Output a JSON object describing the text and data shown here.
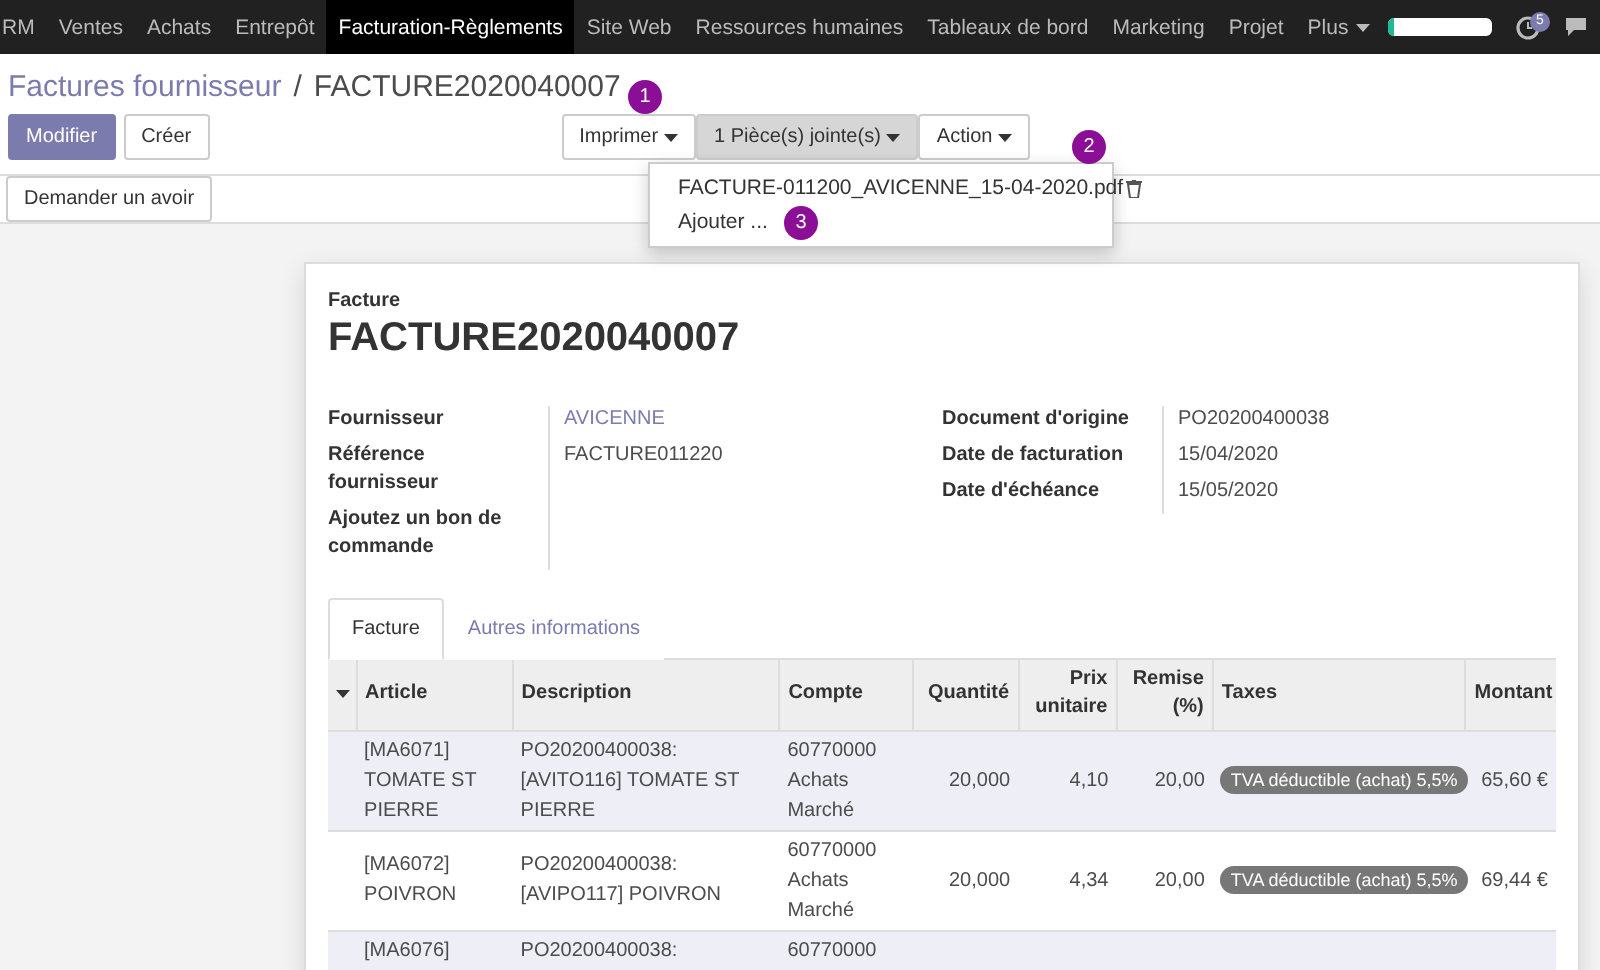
{
  "navbar": {
    "menu": [
      {
        "label": "RM",
        "selected": false
      },
      {
        "label": "Ventes",
        "selected": false
      },
      {
        "label": "Achats",
        "selected": false
      },
      {
        "label": "Entrepôt",
        "selected": false
      },
      {
        "label": "Facturation-Règlements",
        "selected": true
      },
      {
        "label": "Site Web",
        "selected": false
      },
      {
        "label": "Ressources humaines",
        "selected": false
      },
      {
        "label": "Tableaux de bord",
        "selected": false
      },
      {
        "label": "Marketing",
        "selected": false
      },
      {
        "label": "Projet",
        "selected": false
      },
      {
        "label": "Plus",
        "selected": false
      }
    ],
    "progress": {
      "level": 0.05
    },
    "notification_count": "5"
  },
  "breadcrumb": {
    "parent": "Factures fournisseur",
    "separator": "/",
    "current": "FACTURE2020040007"
  },
  "buttons": {
    "edit": "Modifier",
    "create": "Créer",
    "print": "Imprimer",
    "attachments": "1 Pièce(s) jointe(s)",
    "action": "Action",
    "credit_note": "Demander un avoir"
  },
  "attachments_menu": {
    "file": "FACTURE-011200_AVICENNE_15-04-2020.pdf",
    "add": "Ajouter ..."
  },
  "annotations": [
    "1",
    "2",
    "3"
  ],
  "invoice": {
    "type_label": "Facture",
    "number": "FACTURE2020040007",
    "left_fields": [
      {
        "label": "Fournisseur",
        "value": "AVICENNE",
        "kind": "link"
      },
      {
        "label": "Référence fournisseur",
        "value": "FACTURE011220",
        "kind": "text"
      },
      {
        "label": "Ajoutez un bon de commande",
        "kind": "text"
      }
    ],
    "right_fields": [
      {
        "label": "Document d'origine",
        "value": "PO20200400038"
      },
      {
        "label": "Date de facturation",
        "value": "15/04/2020"
      },
      {
        "label": "Date d'échéance",
        "value": "15/05/2020"
      }
    ]
  },
  "tabs": [
    {
      "label": "Facture",
      "selected": true
    },
    {
      "label": "Autres informations",
      "selected": false
    }
  ],
  "table": {
    "columns": [
      "Article",
      "Description",
      "Compte",
      "Quantité",
      "Prix unitaire",
      "Remise (%)",
      "Taxes",
      "Montant"
    ],
    "rows": [
      {
        "article": "[MA6071] TOMATE ST PIERRE",
        "description": "PO20200400038: [AVITO116] TOMATE ST PIERRE",
        "account": "60770000 Achats Marché",
        "quantity": "20,000",
        "unit_price": "4,10",
        "discount": "20,00",
        "tax": "TVA déductible (achat) 5,5%",
        "amount": "65,60 €",
        "selected": true
      },
      {
        "article": "[MA6072] POIVRON",
        "description": "PO20200400038: [AVIPO117] POIVRON",
        "account": "60770000 Achats Marché",
        "quantity": "20,000",
        "unit_price": "4,34",
        "discount": "20,00",
        "tax": "TVA déductible (achat) 5,5%",
        "amount": "69,44 €",
        "selected": false
      },
      {
        "article": "[MA6076]",
        "description": "PO20200400038:",
        "account": "60770000",
        "selected": true
      }
    ]
  }
}
